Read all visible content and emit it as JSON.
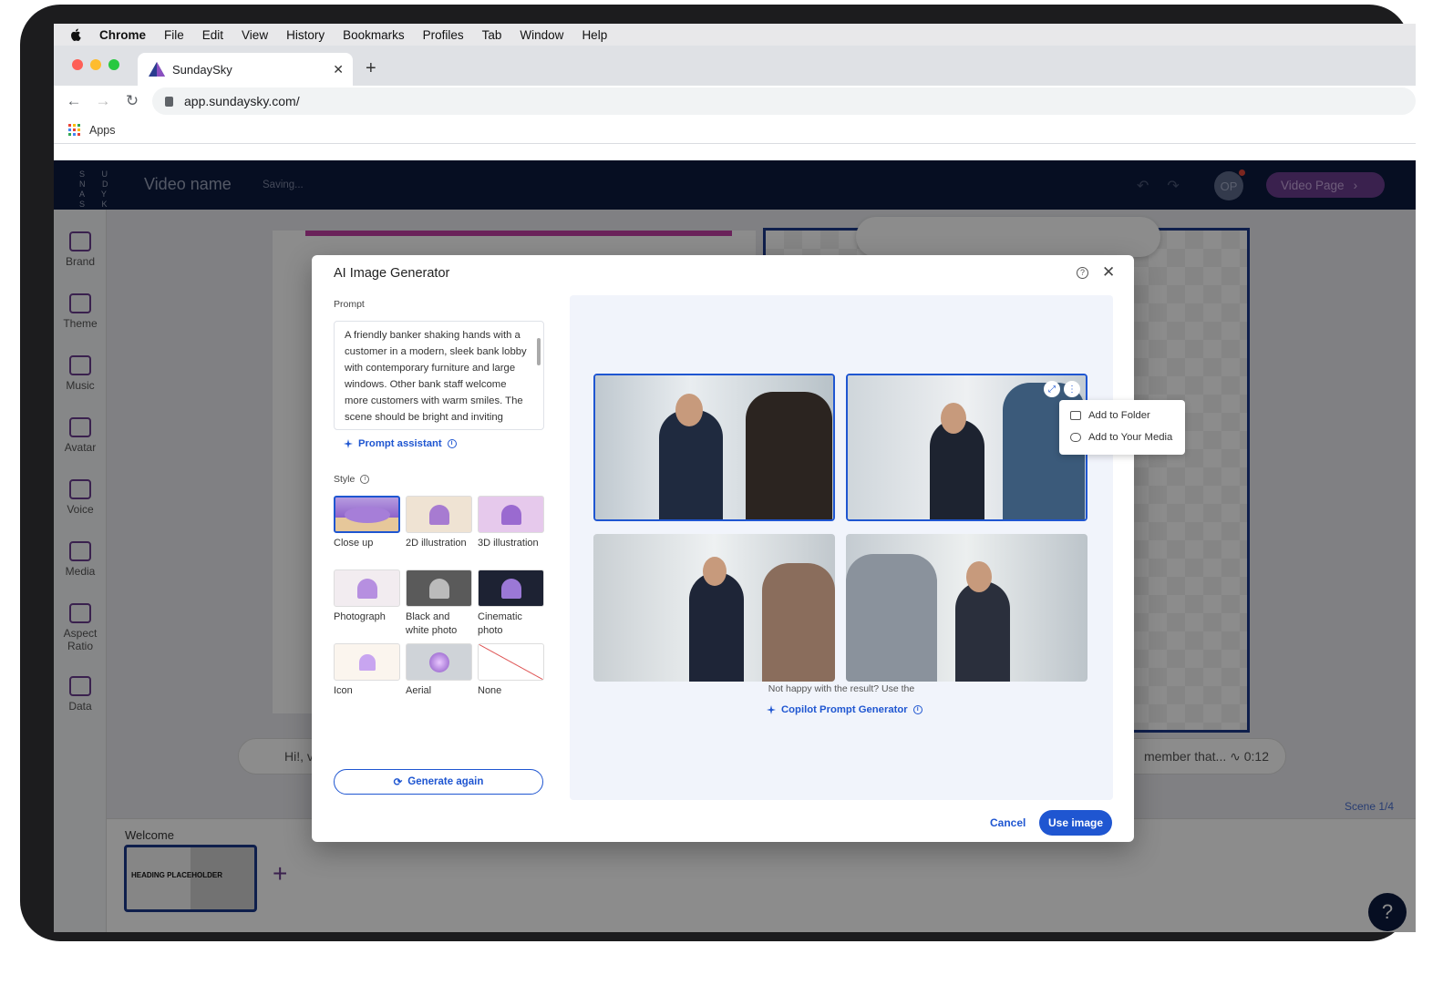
{
  "menubar": {
    "app": "Chrome",
    "items": [
      "File",
      "Edit",
      "View",
      "History",
      "Bookmarks",
      "Profiles",
      "Tab",
      "Window",
      "Help"
    ]
  },
  "browser": {
    "tab_title": "SundaySky",
    "url": "app.sundaysky.com/",
    "bookmark": "Apps"
  },
  "header": {
    "logo": "S U N D A Y S K Y",
    "video_name": "Video name",
    "status": "Saving...",
    "avatar": "OP",
    "video_page": "Video Page"
  },
  "sidebar": {
    "items": [
      "Brand",
      "Theme",
      "Music",
      "Avatar",
      "Voice",
      "Media",
      "Aspect Ratio",
      "Data"
    ]
  },
  "editor": {
    "script_left": "Hi!, v",
    "script_right": "member that...",
    "duration": "∿ 0:12",
    "scene": "Scene 1/4",
    "scene_name": "Welcome",
    "thumb_text": "HEADING PLACEHOLDER",
    "help": "?"
  },
  "modal": {
    "title": "AI Image Generator",
    "prompt_label": "Prompt",
    "prompt_text": "A friendly banker shaking hands with a customer in a modern, sleek bank lobby with contemporary furniture and large windows. Other bank staff welcome more customers with warm smiles. The scene should be bright and inviting",
    "prompt_assistant": "Prompt assistant",
    "style_label": "Style",
    "styles": [
      "Close up",
      "2D illustration",
      "3D illustration",
      "Photograph",
      "Black and white photo",
      "Cinematic photo",
      "Icon",
      "Aerial",
      "None"
    ],
    "selected_style": "Close up",
    "generate_again": "Generate again",
    "context_menu": [
      "Add to Folder",
      "Add to Your Media"
    ],
    "hint": "Not happy with the result? Use the",
    "copilot": "Copilot Prompt Generator",
    "cancel": "Cancel",
    "use_image": "Use image"
  },
  "colors": {
    "accent": "#1f56d1",
    "brand_dark": "#0c1a3e",
    "brand_purple": "#6b3d8f"
  }
}
